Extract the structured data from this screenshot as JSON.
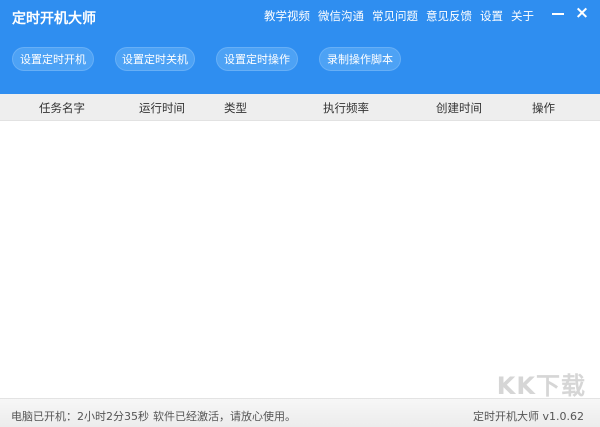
{
  "app": {
    "title": "定时开机大师"
  },
  "top_menu": [
    "教学视频",
    "微信沟通",
    "常见问题",
    "意见反馈",
    "设置",
    "关于"
  ],
  "window_controls": {
    "minimize_icon": "minimize-icon",
    "close_symbol": "×"
  },
  "actions": [
    "设置定时开机",
    "设置定时关机",
    "设置定时操作",
    "录制操作脚本"
  ],
  "table": {
    "columns": [
      "任务名字",
      "运行时间",
      "类型",
      "执行频率",
      "创建时间",
      "操作"
    ],
    "rows": []
  },
  "footer": {
    "uptime": "电脑已开机：2小时2分35秒",
    "status": "软件已经激活，请放心使用。",
    "version": "定时开机大师 v1.0.62"
  },
  "watermark": "KK下载",
  "colors": {
    "header": "#2f8ef0",
    "button": "#4da2f5",
    "table_header": "#eeeeee"
  }
}
